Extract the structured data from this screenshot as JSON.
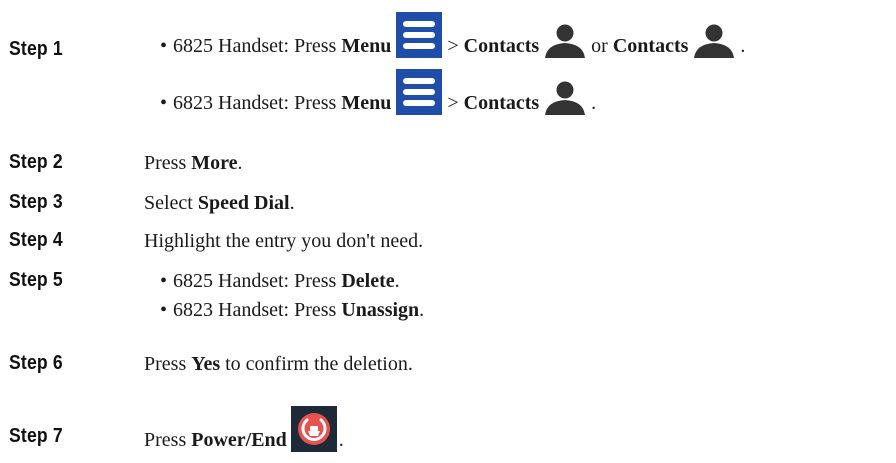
{
  "steps": [
    {
      "label": "Step 1",
      "bullets": [
        {
          "handset": "6825 Handset: Press",
          "menu": "Menu",
          "gt": ">",
          "contacts1": "Contacts",
          "or": "or",
          "contacts2": "Contacts",
          "end": "."
        },
        {
          "handset": "6823 Handset: Press",
          "menu": "Menu",
          "gt": ">",
          "contacts1": "Contacts",
          "end": "."
        }
      ]
    },
    {
      "label": "Step 2",
      "pre": "Press",
      "bold": "More",
      "post": "."
    },
    {
      "label": "Step 3",
      "pre": "Select",
      "bold": "Speed Dial",
      "post": "."
    },
    {
      "label": "Step 4",
      "text": "Highlight the entry you don't need."
    },
    {
      "label": "Step 5",
      "bullets": [
        {
          "pre": "6825 Handset: Press",
          "bold": "Delete",
          "post": "."
        },
        {
          "pre": "6823 Handset: Press",
          "bold": "Unassign",
          "post": "."
        }
      ]
    },
    {
      "label": "Step 6",
      "bold": "Yes",
      "pre": "Press",
      "post": "to confirm the deletion."
    },
    {
      "label": "Step 7",
      "pre": "Press",
      "bold": "Power/End",
      "post": "."
    }
  ],
  "bullet_char": "•",
  "icons": {
    "menu": "menu-icon",
    "contacts": "person-icon",
    "power": "power-end-icon"
  },
  "colors": {
    "menu_icon_bg": "#1f4eaa",
    "power_icon_bg": "#1e2a38",
    "power_icon_fg": "#e8524e",
    "person_icon": "#333333"
  }
}
